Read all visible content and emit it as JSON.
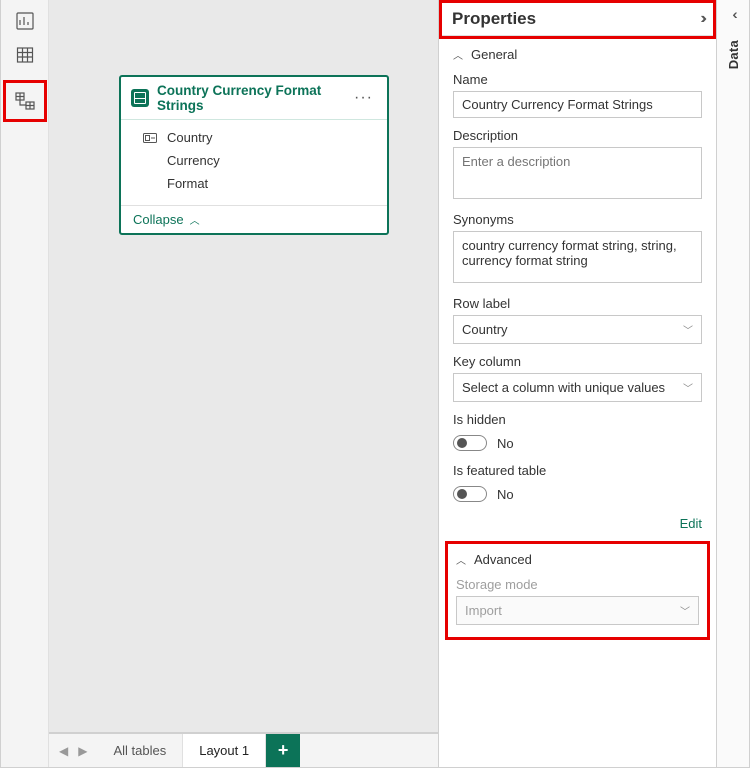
{
  "leftRail": {
    "views": [
      "report-view",
      "data-view",
      "model-view"
    ],
    "active": "model-view"
  },
  "tableCard": {
    "title": "Country Currency Format Strings",
    "fields": [
      {
        "name": "Country",
        "isKey": true
      },
      {
        "name": "Currency",
        "isKey": false
      },
      {
        "name": "Format",
        "isKey": false
      }
    ],
    "collapseLabel": "Collapse"
  },
  "bottomBar": {
    "tab_all": "All tables",
    "tab_layout": "Layout 1",
    "add": "+"
  },
  "properties": {
    "title": "Properties",
    "general": {
      "section": "General",
      "name_label": "Name",
      "name_value": "Country Currency Format Strings",
      "description_label": "Description",
      "description_placeholder": "Enter a description",
      "synonyms_label": "Synonyms",
      "synonyms_value": "country currency format string, string, currency format string",
      "rowlabel_label": "Row label",
      "rowlabel_value": "Country",
      "keycolumn_label": "Key column",
      "keycolumn_value": "Select a column with unique values",
      "ishidden_label": "Is hidden",
      "ishidden_text": "No",
      "isfeatured_label": "Is featured table",
      "isfeatured_text": "No",
      "edit": "Edit"
    },
    "advanced": {
      "section": "Advanced",
      "storagemode_label": "Storage mode",
      "storagemode_value": "Import"
    }
  },
  "rightRail": {
    "label": "Data"
  }
}
